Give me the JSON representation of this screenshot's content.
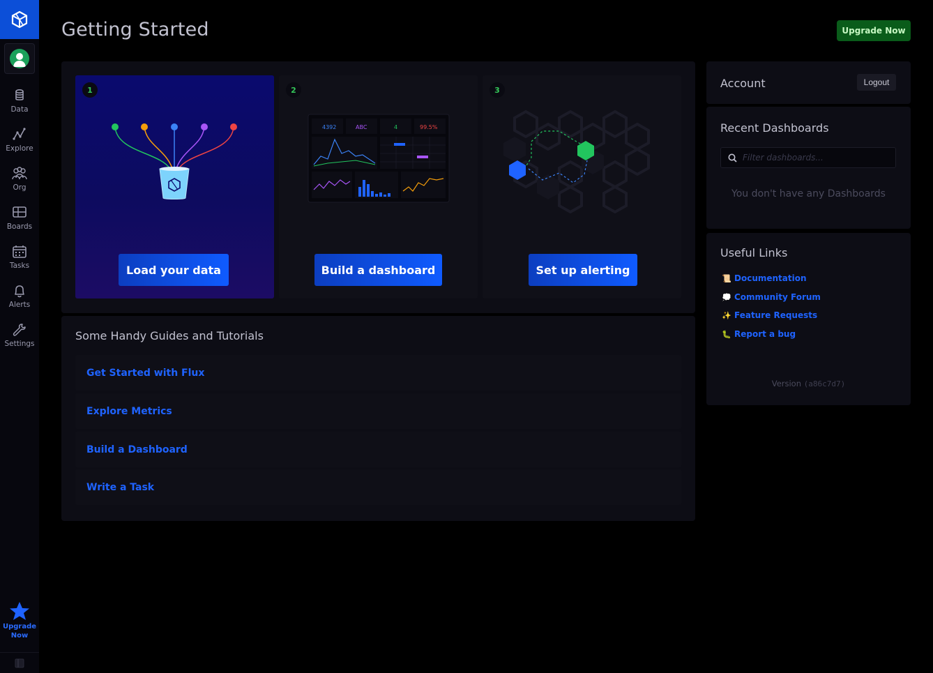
{
  "header": {
    "title": "Getting Started",
    "upgrade_label": "Upgrade Now"
  },
  "sidebar": {
    "items": [
      {
        "label": "Data",
        "icon": "database-icon"
      },
      {
        "label": "Explore",
        "icon": "graph-icon"
      },
      {
        "label": "Org",
        "icon": "users-icon"
      },
      {
        "label": "Boards",
        "icon": "dashboards-icon"
      },
      {
        "label": "Tasks",
        "icon": "calendar-icon"
      },
      {
        "label": "Alerts",
        "icon": "bell-icon"
      },
      {
        "label": "Settings",
        "icon": "wrench-icon"
      }
    ],
    "upgrade_label_1": "Upgrade",
    "upgrade_label_2": "Now"
  },
  "steps": [
    {
      "number": "1",
      "button_label": "Load your data"
    },
    {
      "number": "2",
      "button_label": "Build a dashboard"
    },
    {
      "number": "3",
      "button_label": "Set up alerting"
    }
  ],
  "dashboard_preview": {
    "stat_1": "4392",
    "stat_2": "ABC",
    "stat_3": "4",
    "stat_4": "99.5%"
  },
  "guides": {
    "title": "Some Handy Guides and Tutorials",
    "items": [
      "Get Started with Flux",
      "Explore Metrics",
      "Build a Dashboard",
      "Write a Task"
    ]
  },
  "account": {
    "title": "Account",
    "logout_label": "Logout"
  },
  "recent_dashboards": {
    "title": "Recent Dashboards",
    "search_placeholder": "Filter dashboards...",
    "empty_text": "You don't have any Dashboards"
  },
  "useful_links": {
    "title": "Useful Links",
    "items": [
      {
        "emoji": "📜",
        "label": "Documentation"
      },
      {
        "emoji": "💭",
        "label": "Community Forum"
      },
      {
        "emoji": "✨",
        "label": "Feature Requests"
      },
      {
        "emoji": "🐛",
        "label": "Report a bug"
      }
    ]
  },
  "version": {
    "label": "Version",
    "hash": "(a86c7d7)"
  },
  "colors": {
    "accent_blue": "#0f5bff",
    "upgrade_green": "#0a5c1a",
    "step_number": "#34c759"
  }
}
